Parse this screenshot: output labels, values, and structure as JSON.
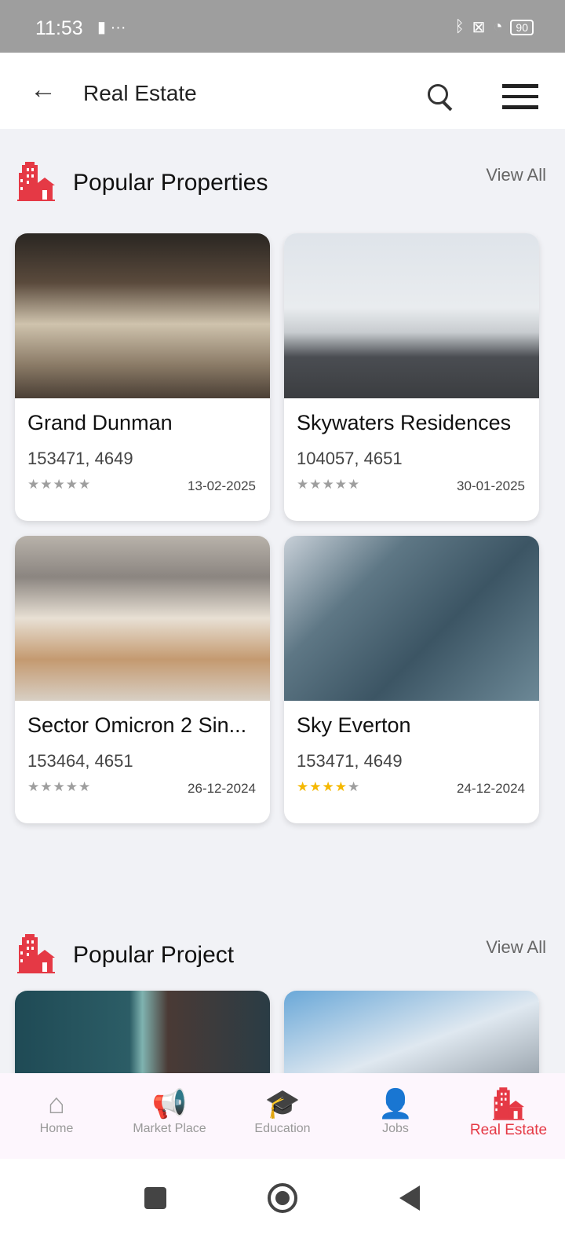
{
  "status_bar": {
    "time": "11:53",
    "battery": "90"
  },
  "header": {
    "title": "Real Estate"
  },
  "colors": {
    "accent": "#e53945",
    "star_filled": "#f5b800",
    "star_empty": "#9e9e9e"
  },
  "popular_properties": {
    "title": "Popular Properties",
    "view_all": "View All",
    "items": [
      {
        "name": "Grand Dunman",
        "code": "153471, 4649",
        "date": "13-02-2025",
        "rating": 0
      },
      {
        "name": "Skywaters Residences",
        "code": "104057, 4651",
        "date": "30-01-2025",
        "rating": 0
      },
      {
        "name": "Sector Omicron 2 Sin...",
        "code": "153464, 4651",
        "date": "26-12-2024",
        "rating": 0
      },
      {
        "name": "Sky Everton",
        "code": "153471, 4649",
        "date": "24-12-2024",
        "rating": 4
      }
    ]
  },
  "popular_project": {
    "title": "Popular Project",
    "view_all": "View All"
  },
  "bottom_nav": [
    {
      "label": "Home",
      "icon": "home-icon"
    },
    {
      "label": "Market Place",
      "icon": "megaphone-icon"
    },
    {
      "label": "Education",
      "icon": "graduation-cap-icon"
    },
    {
      "label": "Jobs",
      "icon": "jobs-icon"
    },
    {
      "label": "Real Estate",
      "icon": "building-icon",
      "active": true
    }
  ]
}
